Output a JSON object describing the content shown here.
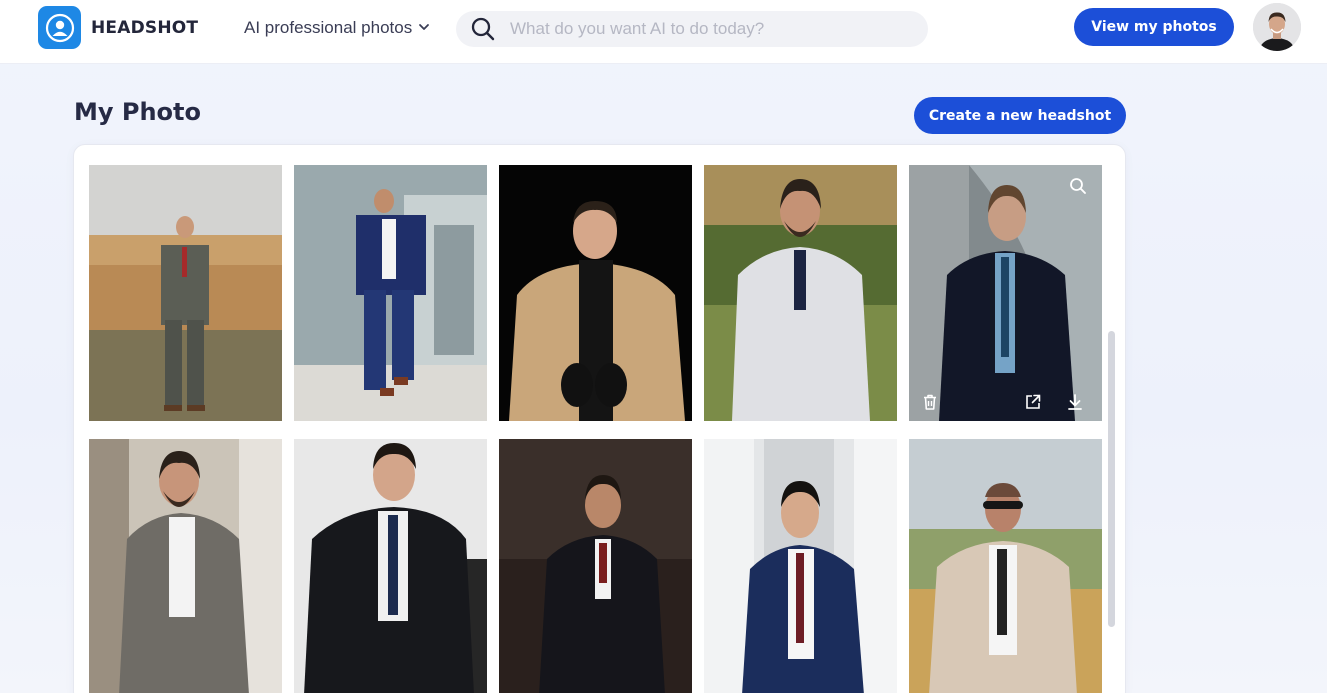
{
  "header": {
    "brand": "HEADSHOT",
    "menu_label": "AI professional photos",
    "search_placeholder": "What do you want AI to do today?",
    "view_button": "View my photos"
  },
  "main": {
    "title": "My Photo",
    "create_button": "Create a new headshot"
  },
  "colors": {
    "accent": "#1c4fd8",
    "logo": "#1e88e5"
  },
  "photos": [
    {
      "id": "p1",
      "description": "man in grey suit standing in dry grass field"
    },
    {
      "id": "p2",
      "description": "man in navy suit walking by glass building"
    },
    {
      "id": "p3",
      "description": "man in camel coat black turtleneck gloves"
    },
    {
      "id": "p4",
      "description": "bearded man in white pinstripe double-breasted suit"
    },
    {
      "id": "p5",
      "description": "man in dark suit in tunnel, hovered with actions"
    },
    {
      "id": "p6",
      "description": "bearded man in grey tweed blazer"
    },
    {
      "id": "p7",
      "description": "young man in black suit seated on chair"
    },
    {
      "id": "p8",
      "description": "man in dark suit arms crossed on dark background"
    },
    {
      "id": "p9",
      "description": "man in navy suit in white corridor"
    },
    {
      "id": "p10",
      "description": "man in beige suit with sunglasses outdoors"
    }
  ],
  "hover_actions": [
    "zoom-icon",
    "delete-icon",
    "share-icon",
    "download-icon"
  ]
}
